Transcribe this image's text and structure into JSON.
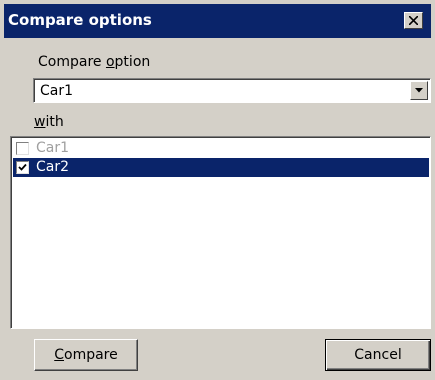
{
  "window": {
    "title": "Compare options",
    "close_icon": "close-icon"
  },
  "compare": {
    "label_prefix": "Compare ",
    "label_mnemonic": "o",
    "label_suffix": "ption",
    "selected_value": "Car1",
    "dropdown_icon": "chevron-down-icon"
  },
  "with": {
    "label_mnemonic": "w",
    "label_suffix": "ith",
    "items": [
      {
        "label": "Car1",
        "checked": false,
        "enabled": false,
        "selected": false
      },
      {
        "label": "Car2",
        "checked": true,
        "enabled": true,
        "selected": true
      }
    ]
  },
  "buttons": {
    "compare_mnemonic": "C",
    "compare_suffix": "ompare",
    "cancel_label": "Cancel"
  },
  "colors": {
    "titlebar": "#0a246a",
    "face": "#d4d0c8",
    "selection": "#0a246a"
  }
}
